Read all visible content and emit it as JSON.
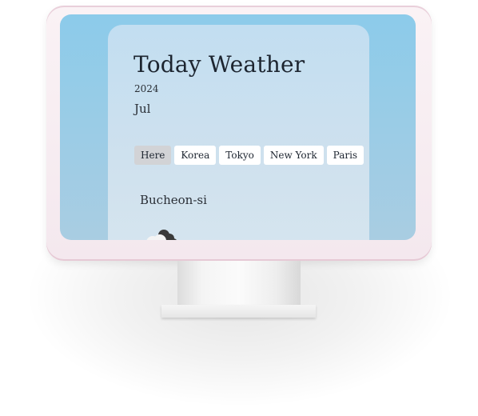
{
  "app": {
    "title": "Today Weather",
    "year": "2024",
    "month": "Jul"
  },
  "tabs": [
    {
      "label": "Here",
      "active": true
    },
    {
      "label": "Korea",
      "active": false
    },
    {
      "label": "Tokyo",
      "active": false
    },
    {
      "label": "New York",
      "active": false
    },
    {
      "label": "Paris",
      "active": false
    }
  ],
  "location": {
    "city": "Bucheon-si"
  },
  "weather": {
    "icon": "cloudy-icon"
  },
  "colors": {
    "screen_bg": "#8ccbea",
    "card_bg": "#c2def1",
    "active_tab": "#d2d3d6",
    "monitor_frame": "#f4e8ee"
  }
}
